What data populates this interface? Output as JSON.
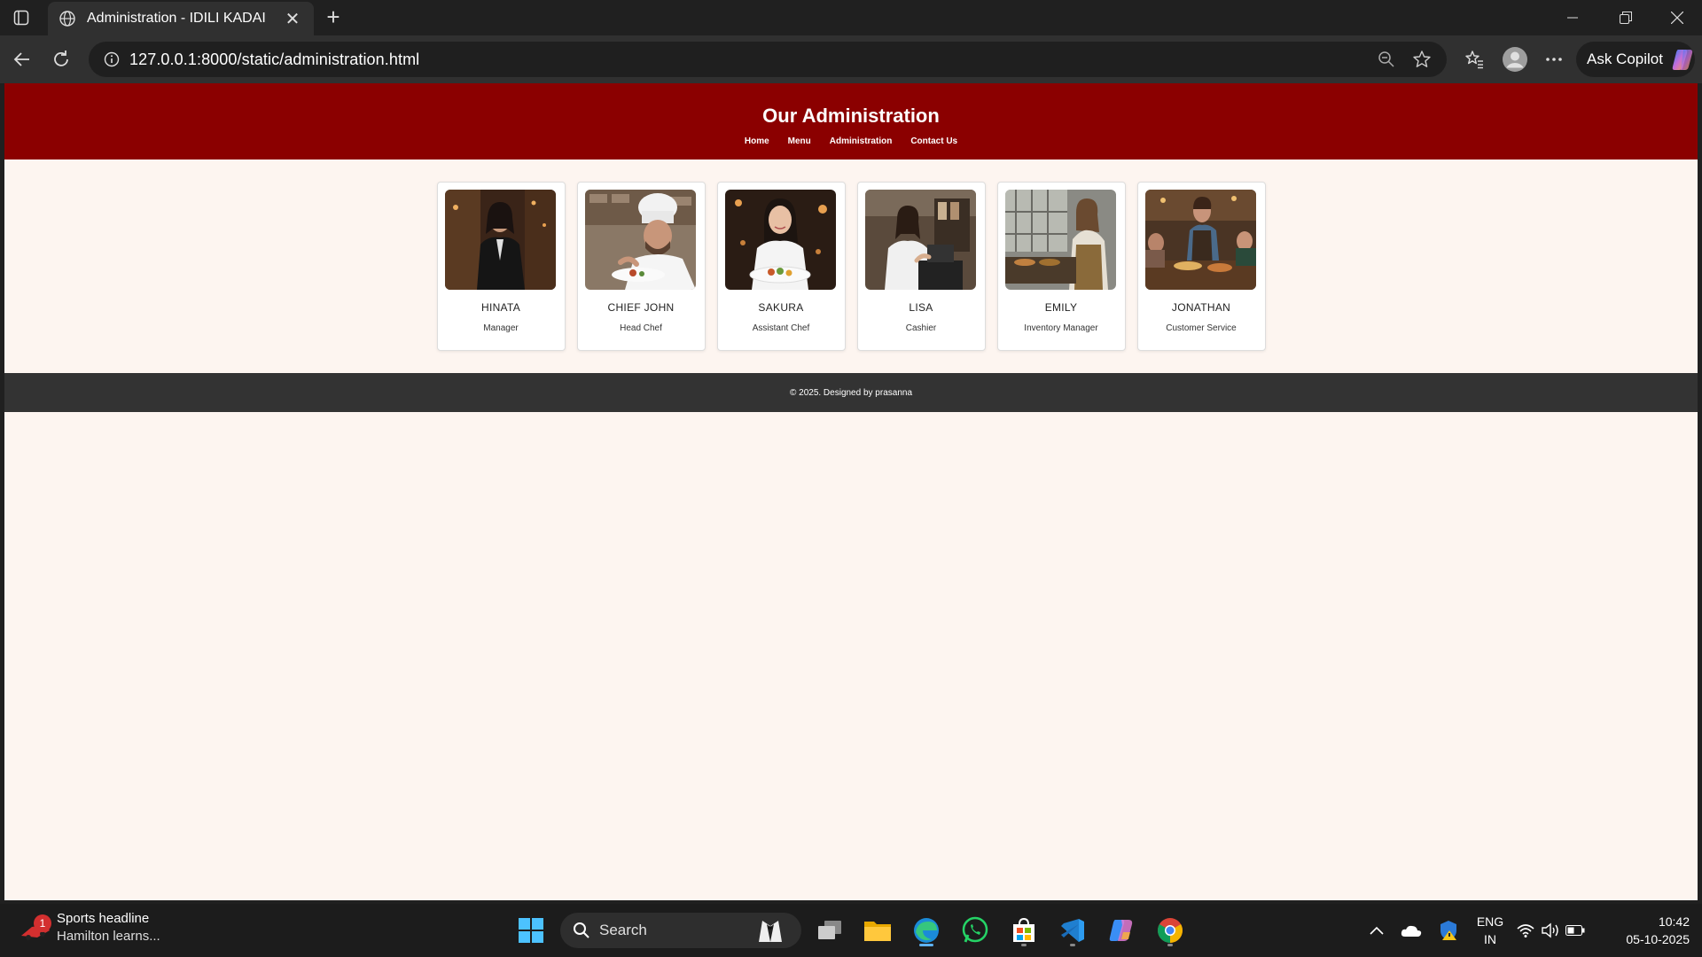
{
  "browser": {
    "tab_title": "Administration - IDILI KADAI",
    "url": "127.0.0.1:8000/static/administration.html",
    "copilot_label": "Ask Copilot"
  },
  "page": {
    "title": "Our Administration",
    "nav": [
      "Home",
      "Menu",
      "Administration",
      "Contact Us"
    ],
    "staff": [
      {
        "name": "HINATA",
        "role": "Manager"
      },
      {
        "name": "CHIEF JOHN",
        "role": "Head Chef"
      },
      {
        "name": "SAKURA",
        "role": "Assistant Chef"
      },
      {
        "name": "LISA",
        "role": "Cashier"
      },
      {
        "name": "EMILY",
        "role": "Inventory Manager"
      },
      {
        "name": "JONATHAN",
        "role": "Customer Service"
      }
    ],
    "footer": "© 2025. Designed by prasanna",
    "colors": {
      "header": "#8b0000",
      "background": "#fdf5f0",
      "footer": "#333333"
    }
  },
  "taskbar": {
    "news_badge": "1",
    "news_title": "Sports headline",
    "news_subtitle": "Hamilton learns...",
    "search_label": "Search",
    "lang_line1": "ENG",
    "lang_line2": "IN",
    "time": "10:42",
    "date": "05-10-2025"
  }
}
